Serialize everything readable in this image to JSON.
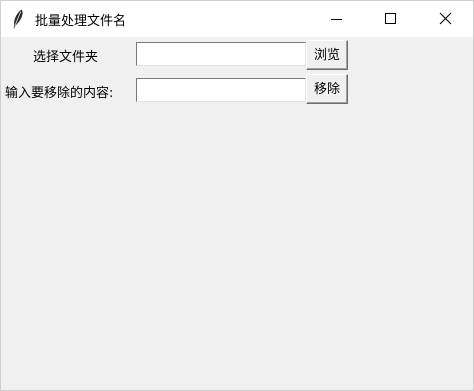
{
  "window": {
    "title": "批量处理文件名",
    "app_icon": "feather-icon",
    "controls": {
      "minimize_icon": "minimize-icon",
      "maximize_icon": "maximize-icon",
      "close_icon": "close-icon"
    }
  },
  "form": {
    "folder_label": "选择文件夹",
    "folder_value": "",
    "browse_label": "浏览",
    "remove_label": "输入要移除的内容:",
    "remove_value": "",
    "remove_button_label": "移除"
  }
}
